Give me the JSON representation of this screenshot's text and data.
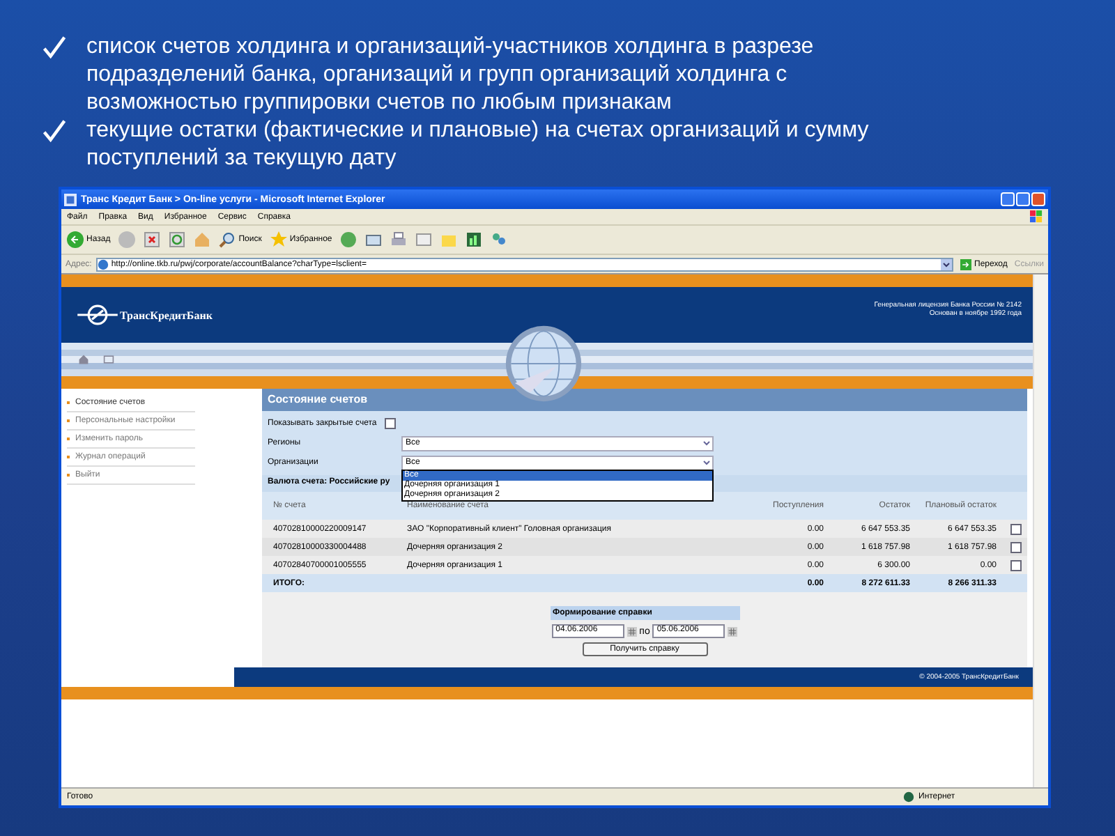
{
  "slide": {
    "bullets": [
      {
        "text": "список счетов холдинга и организаций-участников холдинга в разрезе подразделений банка, организаций  и групп организаций холдинга  с возможностью группировки счетов по любым признакам"
      },
      {
        "text": "текущие остатки (фактические и плановые) на счетах организаций и сумму поступлений за текущую дату"
      }
    ]
  },
  "window": {
    "title": "Транс Кредит Банк > On-line услуги - Microsoft Internet Explorer",
    "menu": [
      "Файл",
      "Правка",
      "Вид",
      "Избранное",
      "Сервис",
      "Справка"
    ],
    "toolbar": {
      "back": "Назад",
      "search": "Поиск",
      "favorites": "Избранное"
    },
    "address": {
      "label": "Адрес:",
      "url": "http://online.tkb.ru/pwj/corporate/accountBalance?charType=lsclient=",
      "go": "Переход",
      "links": "Ссылки"
    },
    "status_bar": {
      "text": "Готово",
      "zone": "Интернет"
    }
  },
  "page": {
    "bank_name": "ТрансКредитБанк",
    "license": [
      "Генеральная лицензия Банка России № 2142",
      "Основан в ноябре 1992 года"
    ],
    "sidebar": [
      {
        "label": "Состояние счетов",
        "selected": true
      },
      {
        "label": "Персональные настройки",
        "selected": false
      },
      {
        "label": "Изменить пароль",
        "selected": false
      },
      {
        "label": "Журнал операций",
        "selected": false
      },
      {
        "label": "Выйти",
        "selected": false
      }
    ],
    "section_title": "Состояние счетов",
    "show_closed": {
      "label": "Показывать закрытые счета",
      "checked": false
    },
    "regions": {
      "label": "Регионы",
      "value": "Все"
    },
    "organizations": {
      "label": "Организации",
      "value": "Все",
      "expanded": true,
      "options": [
        {
          "label": "Все",
          "selected": true
        },
        {
          "label": "Дочерняя организация 1",
          "selected": false
        },
        {
          "label": "Дочерняя организация 2",
          "selected": false
        }
      ]
    },
    "currency": "Валюта счета: Российские ру",
    "table": {
      "columns": [
        "№ счета",
        "Наименование счета",
        "Поступления",
        "Остаток",
        "Плановый остаток"
      ],
      "rows": [
        {
          "cells": [
            "40702810000220009147",
            "ЗАО \"Корпоративный клиент\" Головная организация",
            "0.00",
            "6 647 553.35",
            "6 647 553.35"
          ],
          "checked": false
        },
        {
          "cells": [
            "40702810000330004488",
            "Дочерняя организация 2",
            "0.00",
            "1 618 757.98",
            "1 618 757.98"
          ],
          "checked": false
        },
        {
          "cells": [
            "40702840700001005555",
            "Дочерняя организация 1",
            "0.00",
            "6 300.00",
            "0.00"
          ],
          "checked": false
        }
      ],
      "total": {
        "label": "ИТОГО:",
        "values": [
          "0.00",
          "8 272 611.33",
          "8 266 311.33"
        ]
      }
    },
    "report": {
      "title": "Формирование справки",
      "from": "04.06.2006",
      "separator": "по",
      "to": "05.06.2006",
      "button": "Получить справку"
    },
    "footer": "© 2004-2005 ТрансКредитБанк"
  }
}
